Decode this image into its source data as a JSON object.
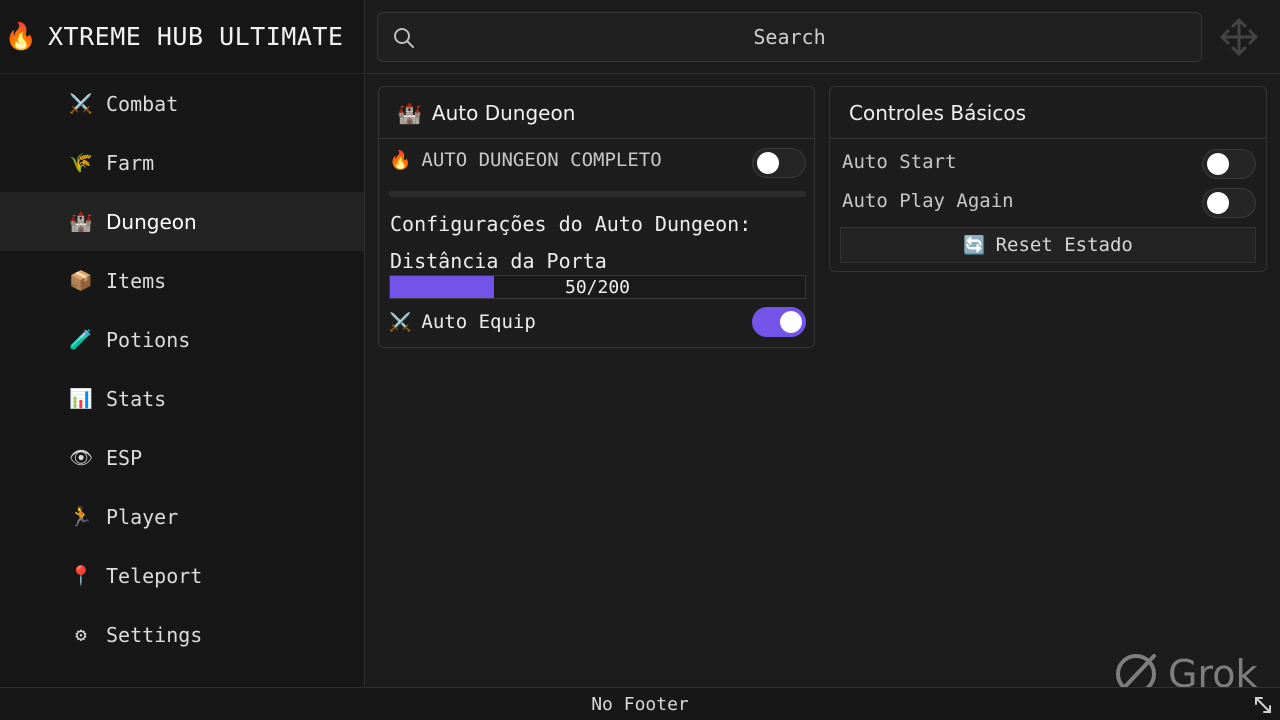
{
  "app": {
    "brand_icon": "🔥",
    "title": "XTREME HUB ULTIMATE"
  },
  "sidebar": {
    "items": [
      {
        "icon": "⚔️",
        "label": "Combat"
      },
      {
        "icon": "🌾",
        "label": "Farm"
      },
      {
        "icon": "🏰",
        "label": "Dungeon"
      },
      {
        "icon": "📦",
        "label": "Items"
      },
      {
        "icon": "🧪",
        "label": "Potions"
      },
      {
        "icon": "📊",
        "label": "Stats"
      },
      {
        "icon": "👁",
        "label": "ESP"
      },
      {
        "icon": "🏃",
        "label": "Player"
      },
      {
        "icon": "📍",
        "label": "Teleport"
      },
      {
        "icon": "⚙",
        "label": "Settings"
      }
    ],
    "active": "Dungeon"
  },
  "search": {
    "placeholder": "Search"
  },
  "panel_auto_dungeon": {
    "icon": "🏰",
    "title": "Auto Dungeon",
    "main_toggle_icon": "🔥",
    "main_toggle_label": "AUTO DUNGEON COMPLETO",
    "main_toggle_on": false,
    "section_title": "Configurações do Auto Dungeon:",
    "slider_label": "Distância da Porta",
    "slider_value": 50,
    "slider_max": 200,
    "slider_text": "50/200",
    "equip_icon": "⚔️",
    "equip_label": "Auto Equip",
    "equip_on": true
  },
  "panel_controls": {
    "title": "Controles Básicos",
    "auto_start_label": "Auto Start",
    "auto_start_on": false,
    "auto_play_label": "Auto Play Again",
    "auto_play_on": false,
    "reset_icon": "🔄",
    "reset_label": "Reset Estado"
  },
  "footer": {
    "text": "No Footer"
  },
  "watermark": {
    "text": "Grok"
  },
  "colors": {
    "accent": "#7453e8",
    "background": "#1c1c1c",
    "sidebar": "#171717"
  }
}
